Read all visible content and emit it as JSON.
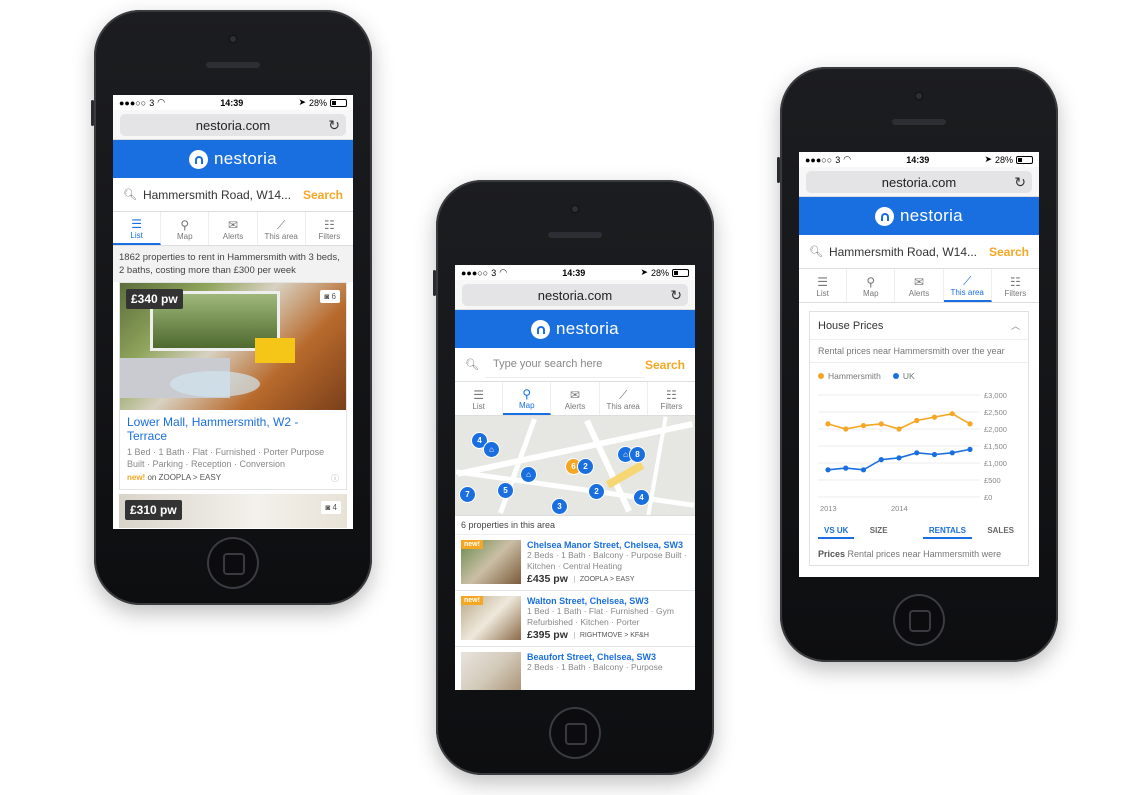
{
  "status": {
    "carrier": "3",
    "time": "14:39",
    "battery": "28%"
  },
  "browser": {
    "url": "nestoria.com"
  },
  "brand": {
    "name": "nestoria"
  },
  "tabs": [
    "List",
    "Map",
    "Alerts",
    "This area",
    "Filters"
  ],
  "phone1": {
    "search_query": "Hammersmith Road, W14...",
    "search_button": "Search",
    "results_summary": "1862 properties to rent in Hammersmith with 3 beds, 2 baths, costing more than £300 per week",
    "listing": {
      "price": "£340 pw",
      "photo_count": "6",
      "title": "Lower Mall, Hammersmith, W2 - Terrace",
      "features": "1 Bed · 1 Bath · Flat · Furnished · Porter Purpose Built · Parking · Reception · Conversion",
      "new_label": "new!",
      "source": "on ZOOPLA > EASY"
    },
    "listing2": {
      "price": "£310 pw",
      "photo_count": "4"
    }
  },
  "phone2": {
    "search_placeholder": "Type your search here",
    "search_button": "Search",
    "map_pins": [
      "4",
      "7",
      "5",
      "6",
      "2",
      "8",
      "2",
      "4",
      "3"
    ],
    "area_count": "6 properties in this area",
    "listings": [
      {
        "new": "new!",
        "title": "Chelsea Manor Street, Chelsea, SW3",
        "desc": "2 Beds · 1 Bath · Balcony · Purpose Built · Kitchen · Central Heating",
        "price": "£435 pw",
        "source": "ZOOPLA > EASY"
      },
      {
        "new": "new!",
        "title": "Walton Street, Chelsea, SW3",
        "desc": "1 Bed · 1 Bath · Flat · Furnished · Gym Refurbished · Kitchen · Porter",
        "price": "£395 pw",
        "source": "RIGHTMOVE > KF&H"
      },
      {
        "new": "",
        "title": "Beaufort Street, Chelsea, SW3",
        "desc": "2 Beds · 1 Bath · Balcony · Purpose",
        "price": "",
        "source": ""
      }
    ]
  },
  "phone3": {
    "search_query": "Hammersmith Road, W14...",
    "search_button": "Search",
    "panel_title": "House Prices",
    "panel_subtitle": "Rental prices near Hammersmith over the year",
    "toggles": [
      "VS UK",
      "SIZE",
      "RENTALS",
      "SALES"
    ],
    "footer_bold": "Prices",
    "footer_text": " Rental prices near Hammersmith were"
  },
  "colors": {
    "brand": "#1a6fe0",
    "accent": "#f5a623"
  },
  "chart_data": {
    "type": "line",
    "title": "",
    "x": [
      "2013 Q1",
      "2013 Q2",
      "2013 Q3",
      "2013 Q4",
      "2014 Q1",
      "2014 Q2",
      "2014 Q3",
      "2014 Q4",
      "2015 Q1"
    ],
    "xticks": [
      "2013",
      "2014"
    ],
    "yticks": [
      "£3,000",
      "£2,500",
      "£2,000",
      "£1,500",
      "£1,000",
      "£500",
      "£0"
    ],
    "ylim": [
      0,
      3000
    ],
    "series": [
      {
        "name": "Hammersmith",
        "color": "#f5a623",
        "values": [
          2150,
          2000,
          2100,
          2150,
          2000,
          2250,
          2350,
          2450,
          2150
        ]
      },
      {
        "name": "UK",
        "color": "#1a6fe0",
        "values": [
          800,
          850,
          800,
          1100,
          1150,
          1300,
          1250,
          1300,
          1400
        ]
      }
    ],
    "legend": "top-left"
  }
}
